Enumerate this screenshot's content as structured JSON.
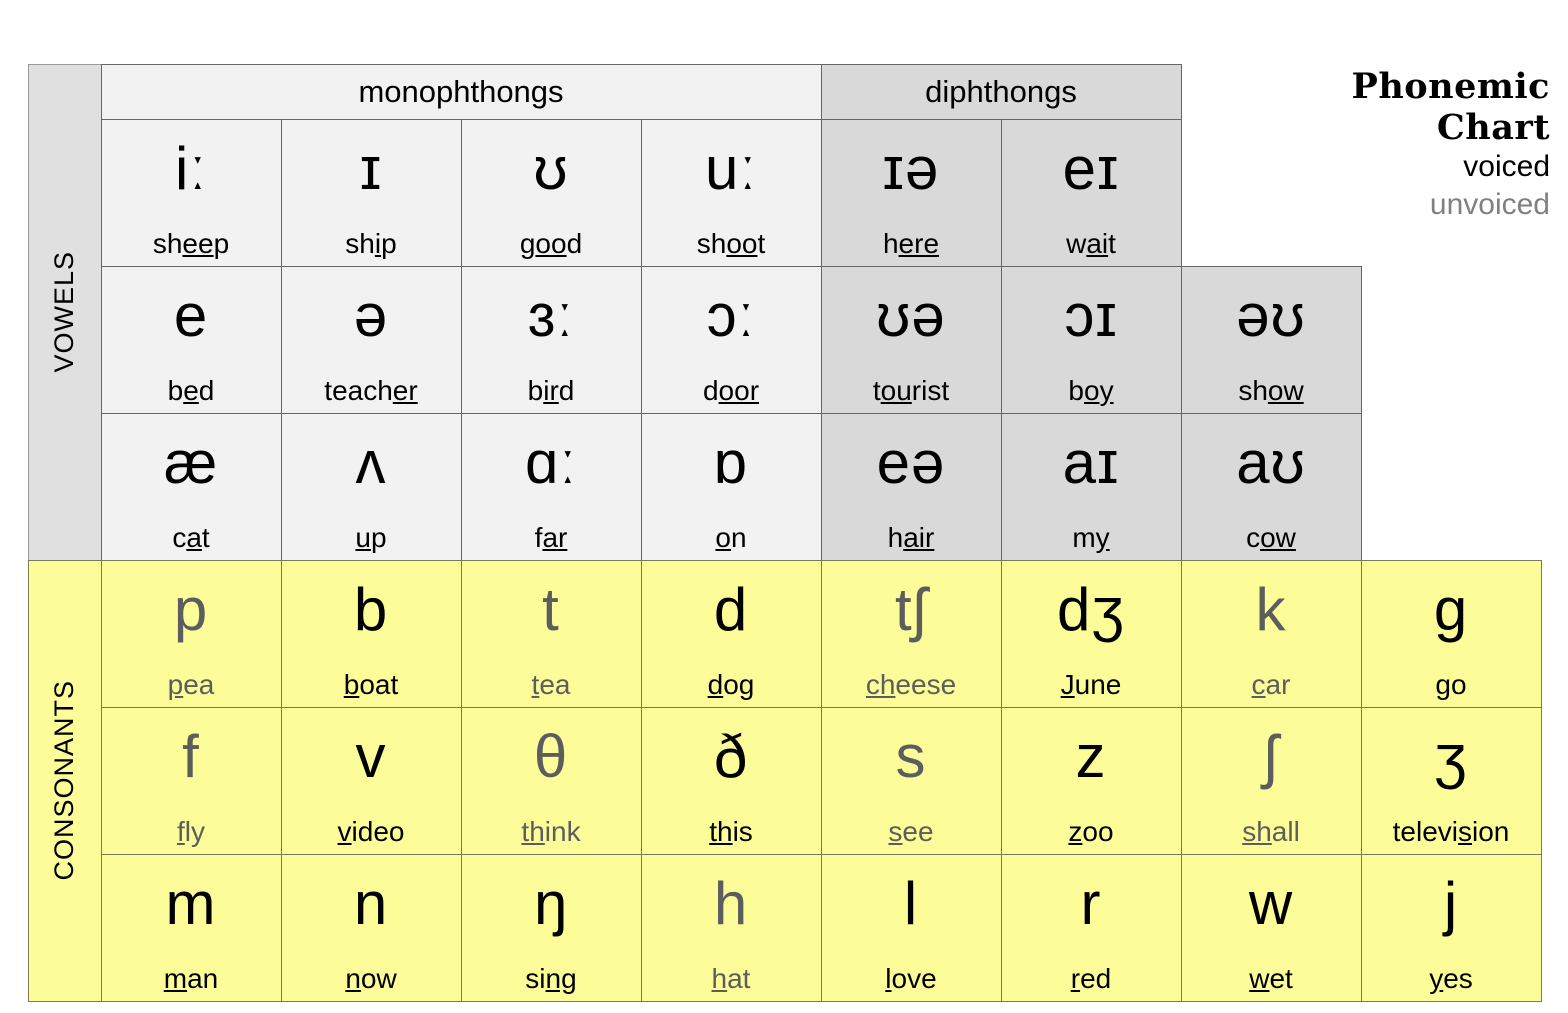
{
  "title": {
    "line1": "Phonemic",
    "line2": "Chart",
    "voiced_label": "voiced",
    "unvoiced_label": "unvoiced",
    "voiced_color": "#000000",
    "unvoiced_color": "#808080"
  },
  "sections": {
    "vowels_label": "VOWELS",
    "consonants_label": "CONSONANTS",
    "monophthongs_label": "monophthongs",
    "diphthongs_label": "diphthongs"
  },
  "colors": {
    "monophthong_bg": "#f2f2f2",
    "diphthong_bg": "#d9d9d9",
    "consonant_bg": "#fcfc99",
    "vowels_sidebar_bg": "#e0e0e0",
    "consonants_sidebar_bg": "#fcfc99"
  },
  "vowels": {
    "row1": [
      {
        "symbol": "iː",
        "word_pre": "sh",
        "word_mid": "ee",
        "word_post": "p",
        "voiced": true
      },
      {
        "symbol": "ɪ",
        "word_pre": "sh",
        "word_mid": "i",
        "word_post": "p",
        "voiced": true
      },
      {
        "symbol": "ʊ",
        "word_pre": "g",
        "word_mid": "oo",
        "word_post": "d",
        "voiced": true
      },
      {
        "symbol": "uː",
        "word_pre": "sh",
        "word_mid": "oo",
        "word_post": "t",
        "voiced": true
      },
      {
        "symbol": "ɪə",
        "word_pre": "h",
        "word_mid": "ere",
        "word_post": "",
        "voiced": true
      },
      {
        "symbol": "eɪ",
        "word_pre": "w",
        "word_mid": "ai",
        "word_post": "t",
        "voiced": true
      }
    ],
    "row2": [
      {
        "symbol": "e",
        "word_pre": "b",
        "word_mid": "e",
        "word_post": "d",
        "voiced": true
      },
      {
        "symbol": "ə",
        "word_pre": "teach",
        "word_mid": "er",
        "word_post": "",
        "voiced": true
      },
      {
        "symbol": "ɜː",
        "word_pre": "b",
        "word_mid": "ir",
        "word_post": "d",
        "voiced": true
      },
      {
        "symbol": "ɔː",
        "word_pre": "d",
        "word_mid": "oor",
        "word_post": "",
        "voiced": true
      },
      {
        "symbol": "ʊə",
        "word_pre": "t",
        "word_mid": "ou",
        "word_post": "rist",
        "voiced": true
      },
      {
        "symbol": "ɔɪ",
        "word_pre": "b",
        "word_mid": "oy",
        "word_post": "",
        "voiced": true
      },
      {
        "symbol": "əʊ",
        "word_pre": "sh",
        "word_mid": "ow",
        "word_post": "",
        "voiced": true
      }
    ],
    "row3": [
      {
        "symbol": "æ",
        "word_pre": "c",
        "word_mid": "a",
        "word_post": "t",
        "voiced": true
      },
      {
        "symbol": "ʌ",
        "word_pre": "",
        "word_mid": "u",
        "word_post": "p",
        "voiced": true
      },
      {
        "symbol": "ɑː",
        "word_pre": "f",
        "word_mid": "ar",
        "word_post": "",
        "voiced": true
      },
      {
        "symbol": "ɒ",
        "word_pre": "",
        "word_mid": "o",
        "word_post": "n",
        "voiced": true
      },
      {
        "symbol": "eə",
        "word_pre": "h",
        "word_mid": "air",
        "word_post": "",
        "voiced": true
      },
      {
        "symbol": "aɪ",
        "word_pre": "m",
        "word_mid": "y",
        "word_post": "",
        "voiced": true
      },
      {
        "symbol": "aʊ",
        "word_pre": "c",
        "word_mid": "ow",
        "word_post": "",
        "voiced": true
      }
    ]
  },
  "consonants": {
    "row1": [
      {
        "symbol": "p",
        "word_pre": "",
        "word_mid": "p",
        "word_post": "ea",
        "voiced": false
      },
      {
        "symbol": "b",
        "word_pre": "",
        "word_mid": "b",
        "word_post": "oat",
        "voiced": true
      },
      {
        "symbol": "t",
        "word_pre": "",
        "word_mid": "t",
        "word_post": "ea",
        "voiced": false
      },
      {
        "symbol": "d",
        "word_pre": "",
        "word_mid": "d",
        "word_post": "og",
        "voiced": true
      },
      {
        "symbol": "tʃ",
        "word_pre": "",
        "word_mid": "ch",
        "word_post": "eese",
        "voiced": false
      },
      {
        "symbol": "dʒ",
        "word_pre": "",
        "word_mid": "J",
        "word_post": "une",
        "voiced": true
      },
      {
        "symbol": "k",
        "word_pre": "",
        "word_mid": "c",
        "word_post": "ar",
        "voiced": false
      },
      {
        "symbol": "g",
        "word_pre": "",
        "word_mid": "g",
        "word_post": "o",
        "voiced": true
      }
    ],
    "row2": [
      {
        "symbol": "f",
        "word_pre": "",
        "word_mid": "f",
        "word_post": "ly",
        "voiced": false
      },
      {
        "symbol": "v",
        "word_pre": "",
        "word_mid": "v",
        "word_post": "ideo",
        "voiced": true
      },
      {
        "symbol": "θ",
        "word_pre": "",
        "word_mid": "th",
        "word_post": "ink",
        "voiced": false
      },
      {
        "symbol": "ð",
        "word_pre": "",
        "word_mid": "th",
        "word_post": "is",
        "voiced": true
      },
      {
        "symbol": "s",
        "word_pre": "",
        "word_mid": "s",
        "word_post": "ee",
        "voiced": false
      },
      {
        "symbol": "z",
        "word_pre": "",
        "word_mid": "z",
        "word_post": "oo",
        "voiced": true
      },
      {
        "symbol": "ʃ",
        "word_pre": "",
        "word_mid": "sh",
        "word_post": "all",
        "voiced": false
      },
      {
        "symbol": "ʒ",
        "word_pre": "televi",
        "word_mid": "s",
        "word_post": "ion",
        "voiced": true
      }
    ],
    "row3": [
      {
        "symbol": "m",
        "word_pre": "",
        "word_mid": "m",
        "word_post": "an",
        "voiced": true
      },
      {
        "symbol": "n",
        "word_pre": "",
        "word_mid": "n",
        "word_post": "ow",
        "voiced": true
      },
      {
        "symbol": "ŋ",
        "word_pre": "si",
        "word_mid": "ng",
        "word_post": "",
        "voiced": true
      },
      {
        "symbol": "h",
        "word_pre": "",
        "word_mid": "h",
        "word_post": "at",
        "voiced": false
      },
      {
        "symbol": "l",
        "word_pre": "",
        "word_mid": "l",
        "word_post": "ove",
        "voiced": true
      },
      {
        "symbol": "r",
        "word_pre": "",
        "word_mid": "r",
        "word_post": "ed",
        "voiced": true
      },
      {
        "symbol": "w",
        "word_pre": "",
        "word_mid": "w",
        "word_post": "et",
        "voiced": true
      },
      {
        "symbol": "j",
        "word_pre": "",
        "word_mid": "y",
        "word_post": "es",
        "voiced": true
      }
    ]
  }
}
